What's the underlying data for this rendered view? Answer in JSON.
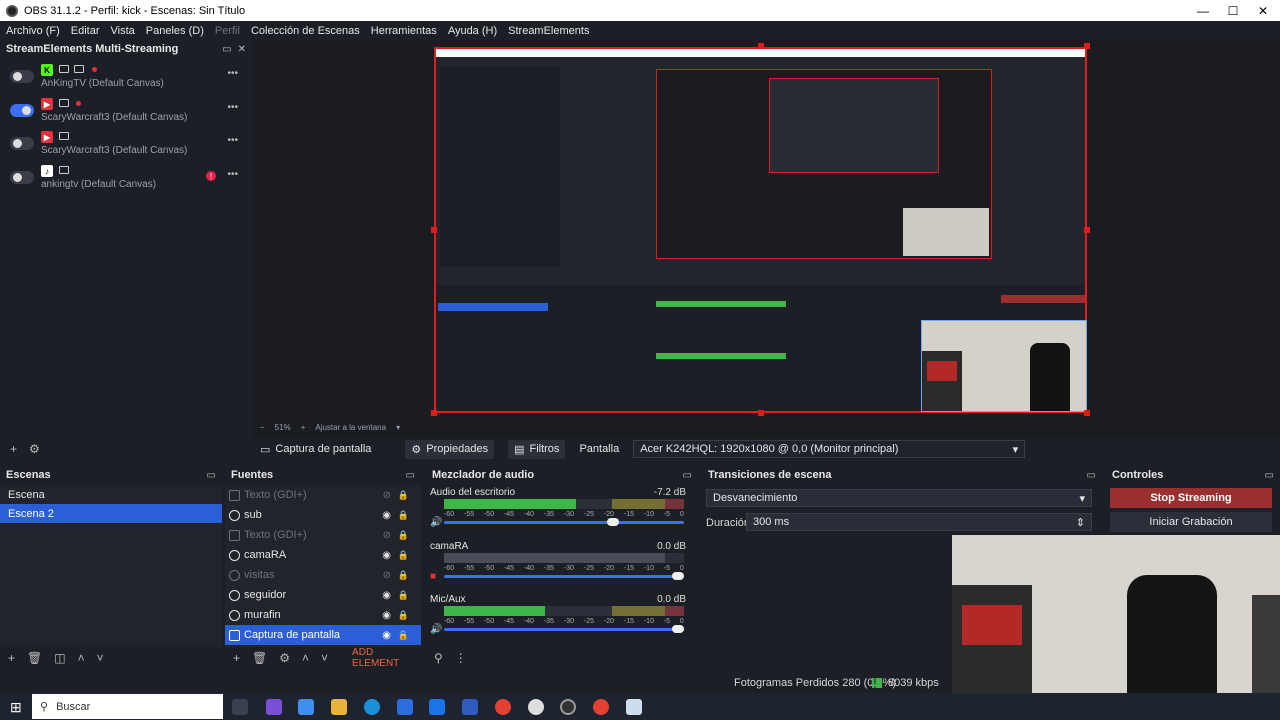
{
  "window": {
    "title": "OBS 31.1.2 - Perfil: kick - Escenas: Sin Título",
    "minimize": "—",
    "maximize": "☐",
    "close": "✕"
  },
  "menu": [
    {
      "label": "Archivo (F)",
      "dim": false
    },
    {
      "label": "Editar",
      "dim": false
    },
    {
      "label": "Vista",
      "dim": false
    },
    {
      "label": "Paneles (D)",
      "dim": false
    },
    {
      "label": "Perfil",
      "dim": true
    },
    {
      "label": "Colección de Escenas",
      "dim": false
    },
    {
      "label": "Herramientas",
      "dim": false
    },
    {
      "label": "Ayuda (H)",
      "dim": false
    },
    {
      "label": "StreamElements",
      "dim": false
    }
  ],
  "multistream": {
    "title": "StreamElements Multi-Streaming",
    "rows": [
      {
        "name": "AnKingTV (Default Canvas)",
        "platform": "kick",
        "on": false
      },
      {
        "name": "ScaryWarcraft3 (Default Canvas)",
        "platform": "youtube",
        "on": true
      },
      {
        "name": "ScaryWarcraft3 (Default Canvas)",
        "platform": "youtube",
        "on": false
      },
      {
        "name": "ankingtv (Default Canvas)",
        "platform": "tiktok",
        "on": false
      }
    ],
    "alert": "!"
  },
  "zoom": {
    "value": "51%",
    "fit_label": "Ajustar a la ventana"
  },
  "source_bar": {
    "source_name": "Captura de pantalla",
    "properties": "Propiedades",
    "filters": "Filtros",
    "screen_label": "Pantalla",
    "screen_value": "Acer K242HQL: 1920x1080 @ 0,0 (Monitor principal)"
  },
  "scenes": {
    "title": "Escenas",
    "items": [
      "Escena",
      "Escena 2"
    ],
    "selected": 1
  },
  "sources": {
    "title": "Fuentes",
    "items": [
      {
        "name": "Texto (GDI+)",
        "dim": true
      },
      {
        "name": "sub",
        "dim": false
      },
      {
        "name": "Texto (GDI+)",
        "dim": true
      },
      {
        "name": "camaRA",
        "dim": false
      },
      {
        "name": "visitas",
        "dim": true
      },
      {
        "name": "seguidor",
        "dim": false
      },
      {
        "name": "murafin",
        "dim": false
      },
      {
        "name": "Captura de pantalla",
        "dim": false,
        "selected": true
      }
    ],
    "add_element": "ADD ELEMENT"
  },
  "mixer": {
    "title": "Mezclador de audio",
    "channels": [
      {
        "name": "Audio del escritorio",
        "db": "-7.2 dB",
        "level": 0.55,
        "volume": 0.7
      },
      {
        "name": "camaRA",
        "db": "0.0 dB",
        "level": 0.0,
        "volume": 1.0
      },
      {
        "name": "Mic/Aux",
        "db": "0.0 dB",
        "level": 0.42,
        "volume": 1.0
      }
    ],
    "ticks": [
      "-60",
      "-55",
      "-50",
      "-45",
      "-40",
      "-35",
      "-30",
      "-25",
      "-20",
      "-15",
      "-10",
      "-5",
      "0"
    ]
  },
  "transitions": {
    "title": "Transiciones de escena",
    "type": "Desvanecimiento",
    "duration_label": "Duración",
    "duration_value": "300 ms"
  },
  "controls": {
    "title": "Controles",
    "stop_streaming": "Stop Streaming",
    "start_recording": "Iniciar Grabación"
  },
  "status": {
    "dropped": "Fotogramas Perdidos 280 (0.0%)",
    "kbps": "8039 kbps"
  },
  "taskbar": {
    "search": "Buscar"
  },
  "colors": {
    "accent": "#2a5fd8",
    "stop": "#9b2e2e",
    "record": "#e11c1c",
    "meter_green": "#3fb64a"
  }
}
